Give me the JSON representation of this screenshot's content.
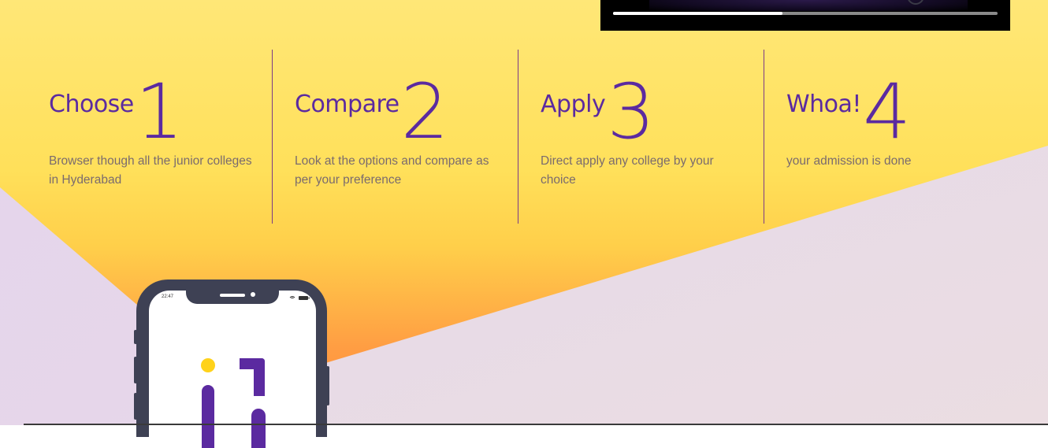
{
  "video": {
    "progress": 0.44
  },
  "steps": [
    {
      "word": "Choose",
      "number": "1",
      "description": "Browser though all the junior colleges in Hyderabad"
    },
    {
      "word": "Compare",
      "number": "2",
      "description": "Look at the options and compare as per your preference"
    },
    {
      "word": "Apply",
      "number": "3",
      "description": "Direct apply any college by your choice"
    },
    {
      "word": "Whoa!",
      "number": "4",
      "description": "your admission is done"
    }
  ],
  "phone": {
    "clock": "22:47"
  },
  "colors": {
    "accent": "#5b2aa0",
    "logo_yellow": "#ffd21a"
  }
}
